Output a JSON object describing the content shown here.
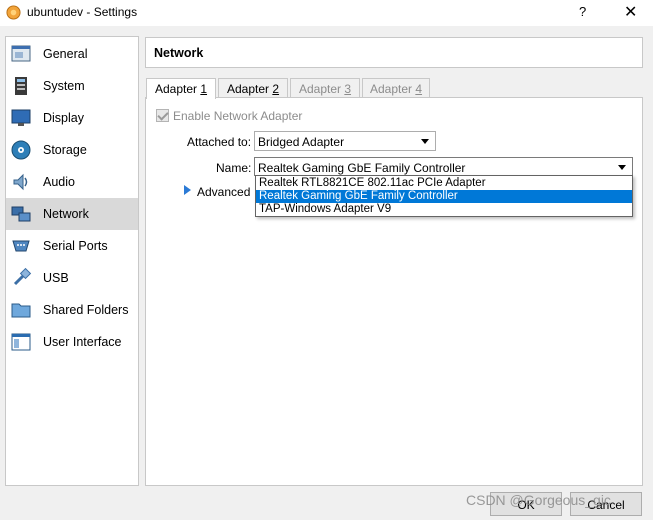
{
  "window": {
    "title": "ubuntudev - Settings",
    "help_label": "?",
    "close_label": "✕"
  },
  "sidebar": {
    "items": [
      {
        "label": "General",
        "icon": "general-icon"
      },
      {
        "label": "System",
        "icon": "system-icon"
      },
      {
        "label": "Display",
        "icon": "display-icon"
      },
      {
        "label": "Storage",
        "icon": "storage-icon"
      },
      {
        "label": "Audio",
        "icon": "audio-icon"
      },
      {
        "label": "Network",
        "icon": "network-icon",
        "selected": true
      },
      {
        "label": "Serial Ports",
        "icon": "serial-ports-icon"
      },
      {
        "label": "USB",
        "icon": "usb-icon"
      },
      {
        "label": "Shared Folders",
        "icon": "shared-folders-icon"
      },
      {
        "label": "User Interface",
        "icon": "user-interface-icon"
      }
    ]
  },
  "page": {
    "title": "Network"
  },
  "tabs": [
    {
      "label": "Adapter ",
      "num": "1",
      "state": "active"
    },
    {
      "label": "Adapter ",
      "num": "2",
      "state": "normal"
    },
    {
      "label": "Adapter ",
      "num": "3",
      "state": "disabled"
    },
    {
      "label": "Adapter ",
      "num": "4",
      "state": "disabled"
    }
  ],
  "adapter": {
    "enable_label": "Enable Network Adapter",
    "attached_label": "Attached to:",
    "attached_value": "Bridged Adapter",
    "name_label": "Name:",
    "name_value": "Realtek Gaming GbE Family Controller",
    "advanced_label": "Advanced"
  },
  "dropdown": {
    "options": [
      "Realtek RTL8821CE 802.11ac PCIe Adapter",
      "Realtek Gaming GbE Family Controller",
      "TAP-Windows Adapter V9"
    ],
    "highlighted_index": 1
  },
  "buttons": {
    "ok_label": "OK",
    "cancel_label": "Cancel"
  },
  "watermark": "CSDN @Gorgeous_gic",
  "colors": {
    "accent": "#0078d7",
    "selection_bg": "#d9d9d9"
  }
}
